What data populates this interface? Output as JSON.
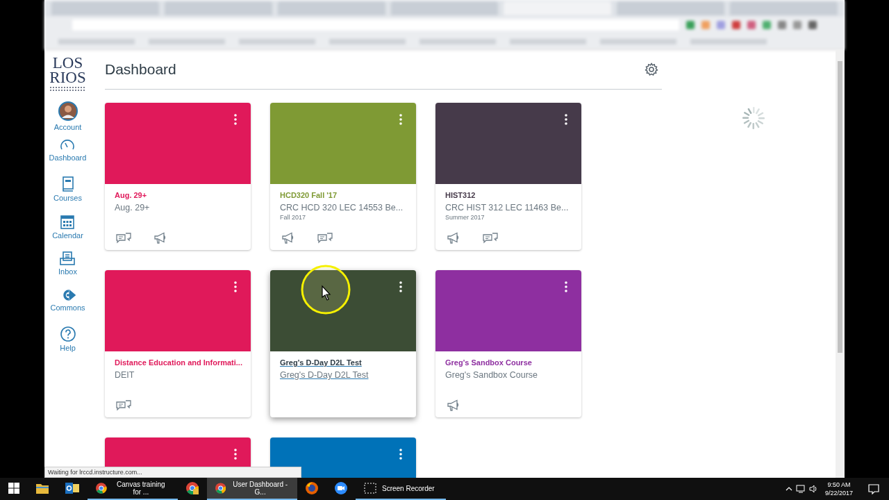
{
  "logo": {
    "line_1": "LOS",
    "line_2": "RIOS"
  },
  "sidebar": {
    "items": [
      {
        "kind": "avatar",
        "label": "Account"
      },
      {
        "kind": "dashboard",
        "label": "Dashboard"
      },
      {
        "kind": "courses",
        "label": "Courses"
      },
      {
        "kind": "calendar",
        "label": "Calendar"
      },
      {
        "kind": "inbox",
        "label": "Inbox"
      },
      {
        "kind": "commons",
        "label": "Commons"
      },
      {
        "kind": "help",
        "label": "Help"
      }
    ]
  },
  "header": {
    "title": "Dashboard"
  },
  "cards": [
    {
      "color": "#e0195a",
      "title": "Aug. 29+",
      "subtitle": "Aug. 29+",
      "hovered": false,
      "icons": [
        {
          "kind": "discussion"
        },
        {
          "kind": "announcement"
        }
      ]
    },
    {
      "color": "#7f9a34",
      "title": "HCD320 Fall '17",
      "subtitle": "CRC HCD 320 LEC 14553 Be...",
      "term": "Fall 2017",
      "hovered": false,
      "icons": [
        {
          "kind": "announcement"
        },
        {
          "kind": "discussion"
        }
      ]
    },
    {
      "color": "#463a4a",
      "title": "HIST312",
      "subtitle": "CRC HIST 312 LEC 11463 Be...",
      "term": "Summer 2017",
      "hovered": false,
      "icons": [
        {
          "kind": "announcement"
        },
        {
          "kind": "discussion"
        }
      ]
    },
    {
      "color": "#e0195a",
      "title": "Distance Education and Informati...",
      "subtitle": "DEIT",
      "hovered": false,
      "icons": [
        {
          "kind": "discussion"
        }
      ]
    },
    {
      "color": "#3c4d35",
      "title": "Greg's D-Day D2L Test",
      "subtitle": "Greg's D-Day D2L Test",
      "hovered": true
    },
    {
      "color": "#8e2fa0",
      "title": "Greg's Sandbox Course",
      "subtitle": "Greg's Sandbox Course",
      "hovered": false,
      "icons": [
        {
          "kind": "announcement"
        }
      ]
    },
    {
      "color": "#e0195a",
      "hovered": false
    },
    {
      "color": "#0072b8",
      "hovered": false
    }
  ],
  "status_text": "Waiting for lrccd.instructure.com...",
  "taskbar": {
    "items": [
      {
        "kind": "start"
      },
      {
        "kind": "folder"
      },
      {
        "kind": "outlook"
      },
      {
        "kind": "chrome",
        "label": "Canvas training for ...",
        "selected": false
      },
      {
        "kind": "chrome-alt"
      },
      {
        "kind": "chrome",
        "label": "User Dashboard - G...",
        "selected": true
      },
      {
        "kind": "firefox"
      },
      {
        "kind": "zoom"
      },
      {
        "kind": "recorder",
        "label": "Screen Recorder",
        "selected": false
      }
    ],
    "time": "9:50 AM",
    "date": "9/22/2017"
  }
}
